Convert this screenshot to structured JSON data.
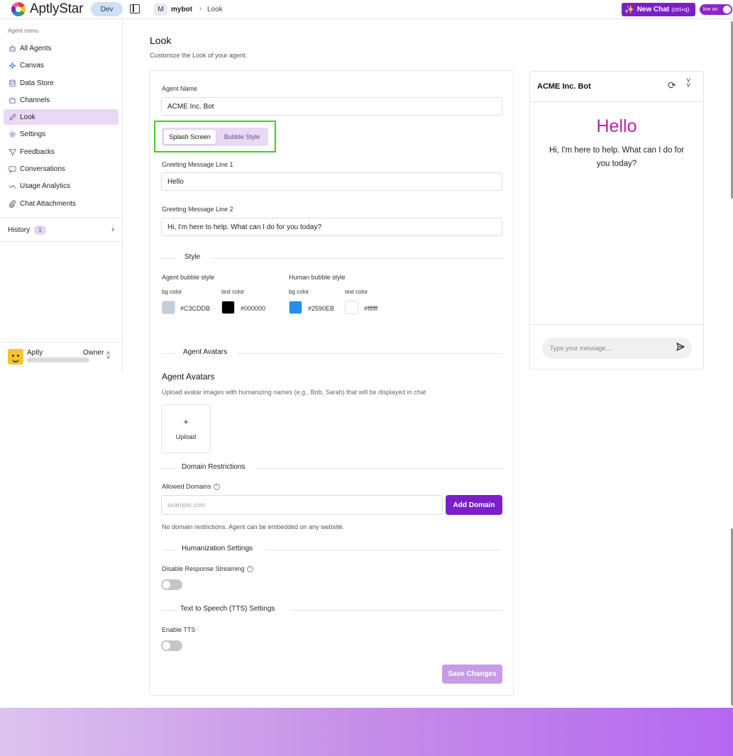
{
  "app": {
    "name": "AptlyStar",
    "env_badge": "Dev"
  },
  "breadcrumb": {
    "bot_initial": "M",
    "bot_name": "mybot",
    "separator": "›",
    "page": "Look"
  },
  "header": {
    "new_chat_label": "New Chat",
    "new_chat_shortcut": "(ctrl+q)",
    "live_label": "live on"
  },
  "sidebar": {
    "section_label": "Agent menu",
    "items": [
      {
        "label": "All Agents",
        "icon": "robot-icon"
      },
      {
        "label": "Canvas",
        "icon": "sparkle-icon"
      },
      {
        "label": "Data Store",
        "icon": "database-icon"
      },
      {
        "label": "Channels",
        "icon": "puzzle-icon"
      },
      {
        "label": "Look",
        "icon": "pen-icon",
        "active": true
      },
      {
        "label": "Settings",
        "icon": "gear-icon"
      },
      {
        "label": "Feedbacks",
        "icon": "send-icon"
      },
      {
        "label": "Conversations",
        "icon": "chat-icon"
      },
      {
        "label": "Usage Analytics",
        "icon": "analytics-icon"
      },
      {
        "label": "Chat Attachments",
        "icon": "paperclip-icon"
      }
    ],
    "history": {
      "label": "History",
      "count": "1"
    },
    "user": {
      "name": "Aptly",
      "role": "Owner"
    }
  },
  "page": {
    "title": "Look",
    "subtitle": "Customize the Look of your agent."
  },
  "form": {
    "agent_name_label": "Agent Name",
    "agent_name_value": "ACME Inc. Bot",
    "tabs": [
      "Splash Screen",
      "Bubble Style"
    ],
    "greeting1_label": "Greeting Message Line 1",
    "greeting1_value": "Hello",
    "greeting2_label": "Greeting Message Line 2",
    "greeting2_value": "Hi, I'm here to help. What can I do for you today?",
    "style_section": "Style",
    "agent_bubble_label": "Agent bubble style",
    "human_bubble_label": "Human bubble style",
    "bg_color_label": "bg color",
    "text_color_label": "text color",
    "agent_bg": "#C3CDDB",
    "agent_text": "#000000",
    "human_bg": "#2590EB",
    "human_text": "#ffffff",
    "avatars_section": "Agent Avatars",
    "avatars_title": "Agent Avatars",
    "avatars_desc": "Upload avatar images with humanizing names (e.g., Bob, Sarah) that will be displayed in chat",
    "upload_plus": "+",
    "upload_label": "Upload",
    "domain_section": "Domain Restrictions",
    "allowed_domains_label": "Allowed Domains",
    "domain_placeholder": "example.com",
    "add_domain_label": "Add Domain",
    "domain_note": "No domain restrictions. Agent can be embedded on any website.",
    "humanization_section": "Humanization Settings",
    "disable_streaming_label": "Disable Response Streaming",
    "tts_section": "Text to Speech (TTS) Settings",
    "enable_tts_label": "Enable TTS",
    "save_label": "Save Changes"
  },
  "preview": {
    "title": "ACME Inc. Bot",
    "hello": "Hello",
    "greeting": "Hi, I'm here to help. What can I do for you today?",
    "input_placeholder": "Type your message..."
  }
}
